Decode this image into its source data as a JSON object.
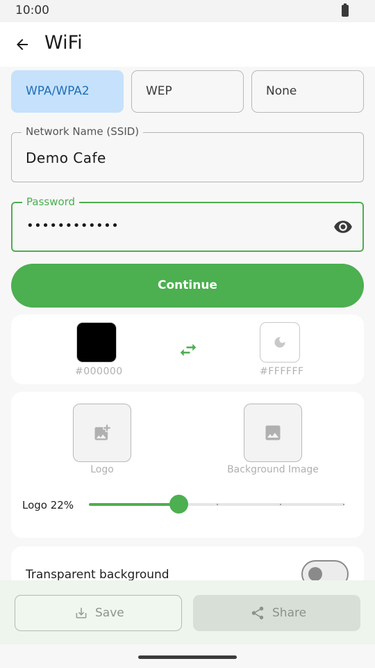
{
  "status": {
    "time": "10:00"
  },
  "header": {
    "title": "WiFi"
  },
  "security": {
    "options": [
      {
        "label": "WPA/WPA2",
        "selected": true
      },
      {
        "label": "WEP",
        "selected": false
      },
      {
        "label": "None",
        "selected": false
      }
    ]
  },
  "ssid": {
    "label": "Network Name (SSID)",
    "value": "Demo Cafe"
  },
  "password": {
    "label": "Password",
    "masked_value": "••••••••••••"
  },
  "continue_label": "Continue",
  "colors": {
    "foreground": "#000000",
    "background": "#FFFFFF",
    "accent": "#4caf50"
  },
  "images": {
    "logo_label": "Logo",
    "background_label": "Background Image"
  },
  "logo_size": {
    "label": "Logo 22%",
    "value_percent": 22
  },
  "transparent_background": {
    "label": "Transparent background",
    "enabled": false
  },
  "actions": {
    "save_label": "Save",
    "share_label": "Share"
  }
}
